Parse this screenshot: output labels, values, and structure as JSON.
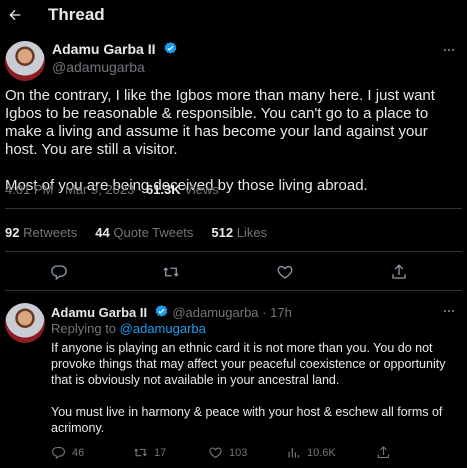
{
  "header": {
    "title": "Thread",
    "back_icon": "arrow-left-icon"
  },
  "colors": {
    "background": "#000000",
    "text": "#e7e9ea",
    "muted": "#71767b",
    "accent": "#1d9bf0"
  },
  "main_tweet": {
    "author_name": "Adamu Garba II",
    "author_handle": "@adamugarba",
    "paragraphs": [
      "On the contrary, I like the Igbos more than many here. I just want Igbos to be reasonable & responsible. You can't go to a place to make a living and assume it has become your land against your host. You are still a visitor.",
      "Most of you are being deceived by those living abroad."
    ],
    "time": "4:01 PM",
    "date": "Mar 9, 2023",
    "views_count": "61.3K",
    "views_label": "Views",
    "retweets_count": "92",
    "retweets_label": "Retweets",
    "quotes_count": "44",
    "quotes_label": "Quote Tweets",
    "likes_count": "512",
    "likes_label": "Likes"
  },
  "reply": {
    "author_name": "Adamu Garba II",
    "author_handle": "@adamugarba",
    "age": "17h",
    "replying_to_label": "Replying to",
    "replying_to_handle": "@adamugarba",
    "paragraphs": [
      "If anyone is playing an ethnic card it is not more than you. You do not provoke things that may affect your peaceful coexistence or opportunity that is obviously not available in your ancestral land.",
      "You must live in harmony & peace with your host & eschew all forms of acrimony."
    ],
    "replies_count": "46",
    "retweets_count": "17",
    "likes_count": "103",
    "views_count": "10.6K"
  }
}
